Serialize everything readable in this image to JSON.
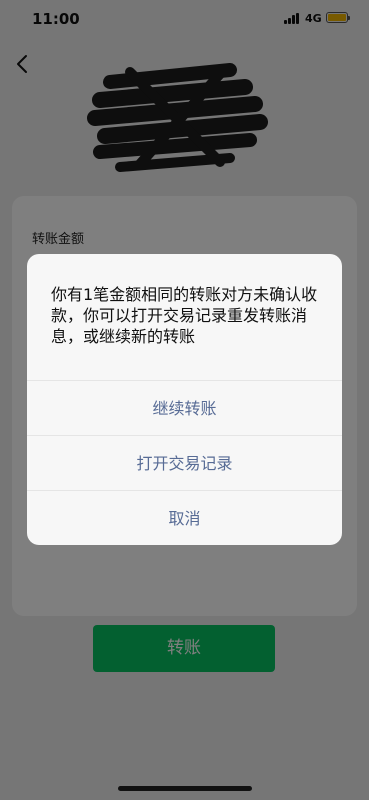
{
  "status_bar": {
    "time": "11:00",
    "network": "4G",
    "signal_icon": "signal-bars-icon",
    "battery_icon": "battery-icon"
  },
  "header": {
    "back_icon": "chevron-left-icon"
  },
  "card": {
    "amount_label": "转账金额"
  },
  "transfer_button": {
    "label": "转账",
    "color": "#07c160"
  },
  "dialog": {
    "message": "你有1笔金额相同的转账对方未确认收款，你可以打开交易记录重发转账消息，或继续新的转账",
    "actions": [
      {
        "label": "继续转账"
      },
      {
        "label": "打开交易记录"
      },
      {
        "label": "取消"
      }
    ],
    "action_color": "#576b95"
  }
}
